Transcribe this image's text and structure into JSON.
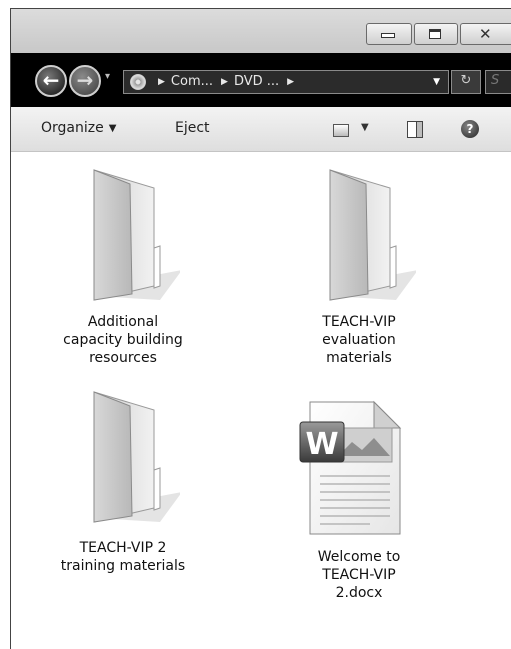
{
  "window": {
    "caption": {
      "minimize_icon": "minimize-icon",
      "maximize_icon": "maximize-icon",
      "close_glyph": "✕"
    }
  },
  "navigation": {
    "back_glyph": "←",
    "forward_glyph": "→",
    "history_glyph": "▾",
    "breadcrumbs": [
      "Com...",
      "DVD ..."
    ],
    "refresh_glyph": "↻",
    "search_placeholder": "S"
  },
  "toolbar": {
    "organize_label": "Organize",
    "eject_label": "Eject",
    "help_label": "?"
  },
  "files": [
    {
      "name_lines": [
        "Additional",
        "capacity building",
        "resources"
      ],
      "type": "folder"
    },
    {
      "name_lines": [
        "TEACH-VIP",
        "evaluation",
        "materials"
      ],
      "type": "folder"
    },
    {
      "name_lines": [
        "TEACH-VIP 2",
        "training materials"
      ],
      "type": "folder"
    },
    {
      "name_lines": [
        "Welcome to",
        "TEACH-VIP",
        "2.docx"
      ],
      "type": "word-document"
    }
  ],
  "colors": {
    "navbar": "#000000",
    "toolbar": "#e8e8e8",
    "content": "#ffffff"
  }
}
